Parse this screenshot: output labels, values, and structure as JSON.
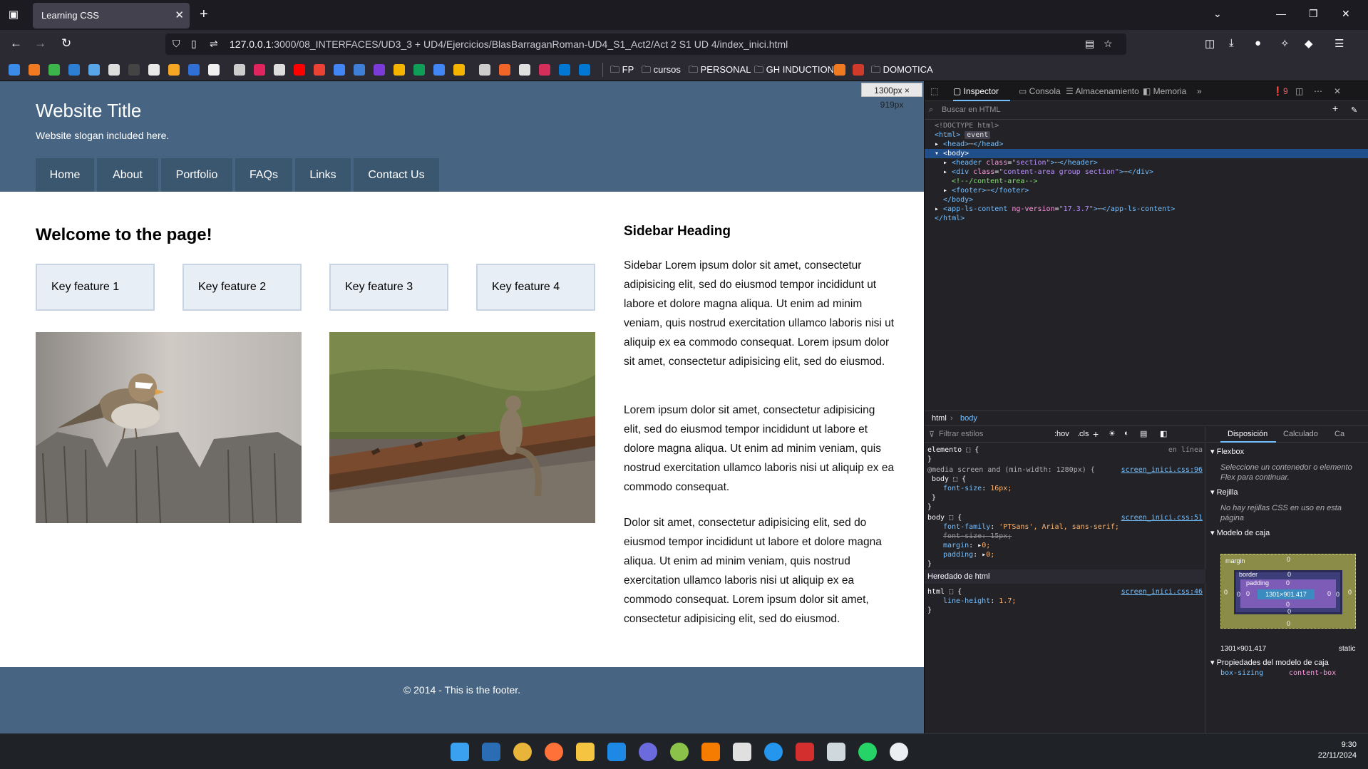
{
  "browser": {
    "tab_title": "Learning CSS",
    "url_host": "127.0.0.1",
    "url_path": ":3000/08_INTERFACES/UD3_3 + UD4/Ejercicios/BlasBarraganRoman-UD4_S1_Act2/Act 2 S1 UD 4/index_inici.html",
    "bookmark_folders": [
      "FP",
      "cursos",
      "PERSONAL",
      "GH INDUCTION",
      "DOMOTICA"
    ],
    "viewport_size": "1300px × 919px"
  },
  "site": {
    "title": "Website Title",
    "slogan": "Website slogan included here.",
    "nav": [
      "Home",
      "About",
      "Portfolio",
      "FAQs",
      "Links",
      "Contact Us"
    ],
    "heading": "Welcome to the page!",
    "features": [
      "Key feature 1",
      "Key feature 2",
      "Key feature 3",
      "Key feature 4"
    ],
    "sidebar_heading": "Sidebar Heading",
    "sidebar_paragraphs": [
      "Sidebar Lorem ipsum dolor sit amet, consectetur adipisicing elit, sed do eiusmod tempor incididunt ut labore et dolore magna aliqua. Ut enim ad minim veniam, quis nostrud exercitation ullamco laboris nisi ut aliquip ex ea commodo consequat. Lorem ipsum dolor sit amet, consectetur adipisicing elit, sed do eiusmod.",
      "Lorem ipsum dolor sit amet, consectetur adipisicing elit, sed do eiusmod tempor incididunt ut labore et dolore magna aliqua. Ut enim ad minim veniam, quis nostrud exercitation ullamco laboris nisi ut aliquip ex ea commodo consequat.",
      "Dolor sit amet, consectetur adipisicing elit, sed do eiusmod tempor incididunt ut labore et dolore magna aliqua. Ut enim ad minim veniam, quis nostrud exercitation ullamco laboris nisi ut aliquip ex ea commodo consequat. Lorem ipsum dolor sit amet, consectetur adipisicing elit, sed do eiusmod."
    ],
    "footer": "© 2014 - This is the footer."
  },
  "devtools": {
    "tabs": [
      "Inspector",
      "Consola",
      "Almacenamiento",
      "Memoria"
    ],
    "error_count": "9",
    "search_placeholder": "Buscar en HTML",
    "markup": {
      "doctype": "<!DOCTYPE html>",
      "html_open": "<html>",
      "event_badge": "event",
      "head": "<head>",
      "head_close": "</head>",
      "body_open": "<body>",
      "header_open": "<header",
      "header_attr": "class",
      "header_val": "\"section\"",
      "header_close": "</header>",
      "div_open": "<div",
      "div_attr": "class",
      "div_val": "\"content-area group section\"",
      "div_close": "</div>",
      "comment": "<!--/content-area-->",
      "footer_open": "<footer>",
      "footer_close": "</footer>",
      "body_close": "</body>",
      "app_open": "<app-ls-content",
      "app_attr": "ng-version",
      "app_val": "\"17.3.7\"",
      "app_close": "</app-ls-content>",
      "html_close": "</html>"
    },
    "breadcrumbs": [
      "html",
      "body"
    ],
    "rules_filter": "Filtrar estilos",
    "rules_toggles": [
      ":hov",
      ".cls"
    ],
    "rules": {
      "elemento": "elemento",
      "en_linea": "en línea",
      "media": "@media screen and (min-width: 1280px) {",
      "src1": "screen_inici.css:96",
      "src2": "screen_inici.css:51",
      "src3": "screen_inici.css:46",
      "font_size_16": "16px;",
      "font_family": "'PTSans', Arial, sans-serif;",
      "font_size_15": "font-size: 15px;",
      "margin": "0;",
      "padding": "0;",
      "inherited": "Heredado de html",
      "line_height": "1.7;"
    },
    "layout_tabs": [
      "Disposición",
      "Calculado",
      "Ca"
    ],
    "flexbox_title": "Flexbox",
    "flexbox_note": "Seleccione un contenedor o elemento Flex para continuar.",
    "grid_title": "Rejilla",
    "grid_note": "No hay rejillas CSS en uso en esta página",
    "boxmodel_title": "Modelo de caja",
    "boxmodel_content": "1301×901.417",
    "boxmodel_size": "1301×901.417",
    "boxmodel_position": "static",
    "boxmodel_props_title": "Propiedades del modelo de caja",
    "box_sizing": "box-sizing",
    "box_sizing_value": "content-box"
  },
  "taskbar": {
    "time": "9:30",
    "date": "22/11/2024"
  }
}
